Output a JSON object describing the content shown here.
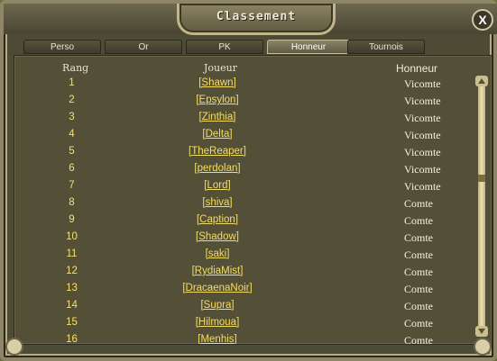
{
  "window": {
    "title": "Classement",
    "close_label": "X"
  },
  "tabs": [
    {
      "label": "Perso"
    },
    {
      "label": "Or"
    },
    {
      "label": "PK"
    },
    {
      "label": "Honneur"
    },
    {
      "label": "Tournois"
    }
  ],
  "active_tab": "Honneur",
  "table": {
    "headers": {
      "rank": "Rang",
      "player": "Joueur",
      "honor": "Honneur"
    },
    "rows": [
      {
        "rank": "1",
        "player": "[Shawn]",
        "title": "Vicomte"
      },
      {
        "rank": "2",
        "player": "[Epsylon]",
        "title": "Vicomte"
      },
      {
        "rank": "3",
        "player": "[Zinthia]",
        "title": "Vicomte"
      },
      {
        "rank": "4",
        "player": "[Delta]",
        "title": "Vicomte"
      },
      {
        "rank": "5",
        "player": "[TheReaper]",
        "title": "Vicomte"
      },
      {
        "rank": "6",
        "player": "[perdolan]",
        "title": "Vicomte"
      },
      {
        "rank": "7",
        "player": "[Lord]",
        "title": "Vicomte"
      },
      {
        "rank": "8",
        "player": "[shiva]",
        "title": "Comte"
      },
      {
        "rank": "9",
        "player": "[Caption]",
        "title": "Comte"
      },
      {
        "rank": "10",
        "player": "[Shadow]",
        "title": "Comte"
      },
      {
        "rank": "11",
        "player": "[saki]",
        "title": "Comte"
      },
      {
        "rank": "12",
        "player": "[RydiaMist]",
        "title": "Comte"
      },
      {
        "rank": "13",
        "player": "[DracaenaNoir]",
        "title": "Comte"
      },
      {
        "rank": "14",
        "player": "[Supra]",
        "title": "Comte"
      },
      {
        "rank": "15",
        "player": "[Hilmoua]",
        "title": "Comte"
      },
      {
        "rank": "16",
        "player": "[Menhis]",
        "title": "Comte"
      }
    ]
  },
  "colors": {
    "rank": "#f7e06b",
    "player_link": "#f4dd63",
    "title": "#f4f0e0",
    "panel": "#545038"
  },
  "icons": {
    "close": "close-icon",
    "scroll_up": "chevron-up-icon",
    "scroll_down": "chevron-down-icon"
  }
}
